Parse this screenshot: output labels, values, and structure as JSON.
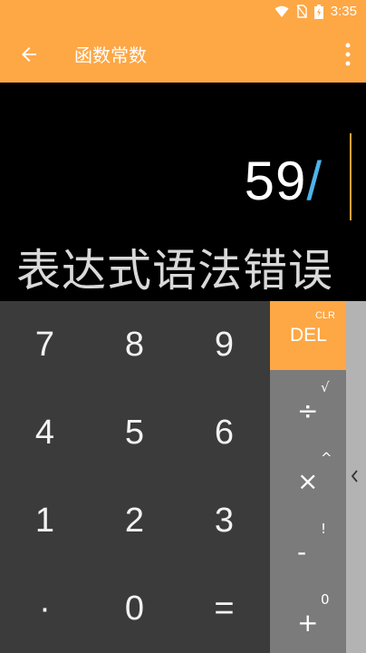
{
  "status_bar": {
    "time": "3:35",
    "icons": [
      "wifi-icon",
      "no-sim-icon",
      "battery-charging-icon"
    ]
  },
  "app_bar": {
    "title": "函数常数",
    "back_icon": "arrow-back-icon",
    "menu_icon": "more-vert-icon",
    "color": "#fea745"
  },
  "display": {
    "expression_number": "59",
    "expression_operator": "/",
    "error_message": "表达式语法错误"
  },
  "keypad": {
    "rows": [
      [
        "7",
        "8",
        "9"
      ],
      [
        "4",
        "5",
        "6"
      ],
      [
        "1",
        "2",
        "3"
      ],
      [
        "·",
        "0",
        "="
      ]
    ]
  },
  "operators": {
    "del_label": "DEL",
    "clr_label": "CLR",
    "items": [
      {
        "main": "÷",
        "secondary": "√"
      },
      {
        "main": "×",
        "secondary": "^"
      },
      {
        "main": "-",
        "secondary": "!"
      },
      {
        "main": "+",
        "secondary": "0"
      }
    ]
  },
  "side_panel": {
    "toggle_icon": "chevron-left-icon"
  }
}
